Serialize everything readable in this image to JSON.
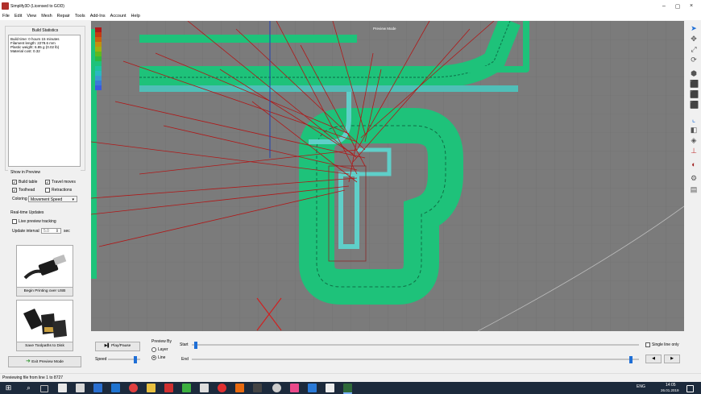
{
  "window": {
    "title": "Simplify3D (Licensed to GOD)",
    "minimize": "–",
    "maximize": "▢",
    "close": "×"
  },
  "menu": [
    "File",
    "Edit",
    "View",
    "Mesh",
    "Repair",
    "Tools",
    "Add-Ins",
    "Account",
    "Help"
  ],
  "build_stats": {
    "title": "Build Statistics",
    "lines": [
      "Build time: 0 hours 15 minutes",
      "Filament length: 2278.6 mm",
      "Plastic weight: 6.85 g (0.02 lb)",
      "Material cost: 0.32"
    ]
  },
  "show_in_preview": {
    "title": "Show in Preview",
    "build_table": "Build table",
    "travel_moves": "Travel moves",
    "toolhead": "Toolhead",
    "retractions": "Retractions",
    "coloring_label": "Coloring",
    "coloring_value": "Movement Speed"
  },
  "realtime": {
    "title": "Real-time Updates",
    "live_tracking": "Live preview tracking",
    "interval_label": "Update interval",
    "interval_value": "5.0",
    "interval_unit": "sec"
  },
  "buttons": {
    "usb": "Begin Printing over USB",
    "save": "Save Toolpaths to Disk",
    "exit": "Exit Preview Mode",
    "play": "Play/Pause"
  },
  "viewport": {
    "mode_label": "Preview Mode"
  },
  "preview_by": {
    "label": "Preview By",
    "layer": "Layer",
    "line": "Line",
    "selected": "line"
  },
  "speed_label": "Speed",
  "start_label": "Start",
  "end_label": "End",
  "single_line": "Single line only",
  "start_fraction": 0.005,
  "end_fraction": 0.985,
  "speed_fraction": 0.9,
  "status": "Previewing file from line 1 to 8727",
  "tray": {
    "lang": "ENG",
    "time": "14:05",
    "date": "26.01.2019"
  },
  "colors": {
    "accent": "#1f6fd6",
    "toolpath_green": "#1ec27a",
    "travel_red": "#b01818",
    "shell_cyan": "#5fcfc9"
  },
  "icons": [
    "select-arrow-icon",
    "move-icon",
    "scale-icon",
    "rotate-icon",
    "view-iso-icon",
    "view-front-icon",
    "view-top-icon",
    "view-side-icon",
    "cross-section-icon",
    "cube-icon",
    "mesh-icon",
    "axes-icon",
    "material-icon",
    "gear-icon",
    "layers-icon"
  ]
}
